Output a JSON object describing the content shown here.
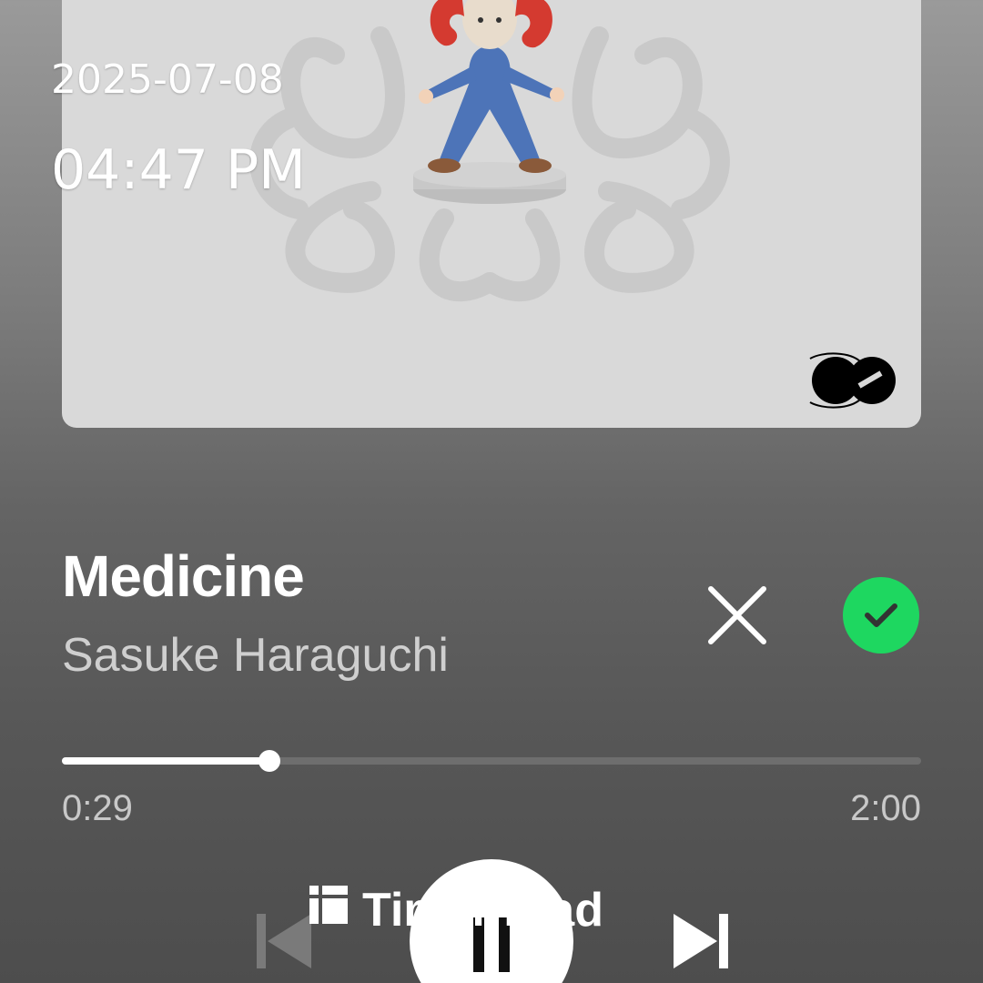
{
  "status_overlay": {
    "date": "2025-07-08",
    "time": "04:47 PM"
  },
  "track": {
    "title": "Medicine",
    "artist": "Sasuke Haraguchi"
  },
  "playback": {
    "elapsed": "0:29",
    "total": "2:00",
    "progress_fraction": 0.2417,
    "is_playing": true
  },
  "overlay": {
    "label": "Timer read",
    "icon": "grid-icon"
  },
  "icons": {
    "close": "close-icon",
    "liked": "check-circle-icon",
    "previous": "skip-previous-icon",
    "pause": "pause-icon",
    "next": "skip-next-icon",
    "label_logo": "record-label-logo"
  },
  "colors": {
    "accent_green": "#1ed760",
    "artwork_bg": "#d9d9d9",
    "progress_track": "#6e6e6e",
    "progress_fill": "#ffffff"
  }
}
